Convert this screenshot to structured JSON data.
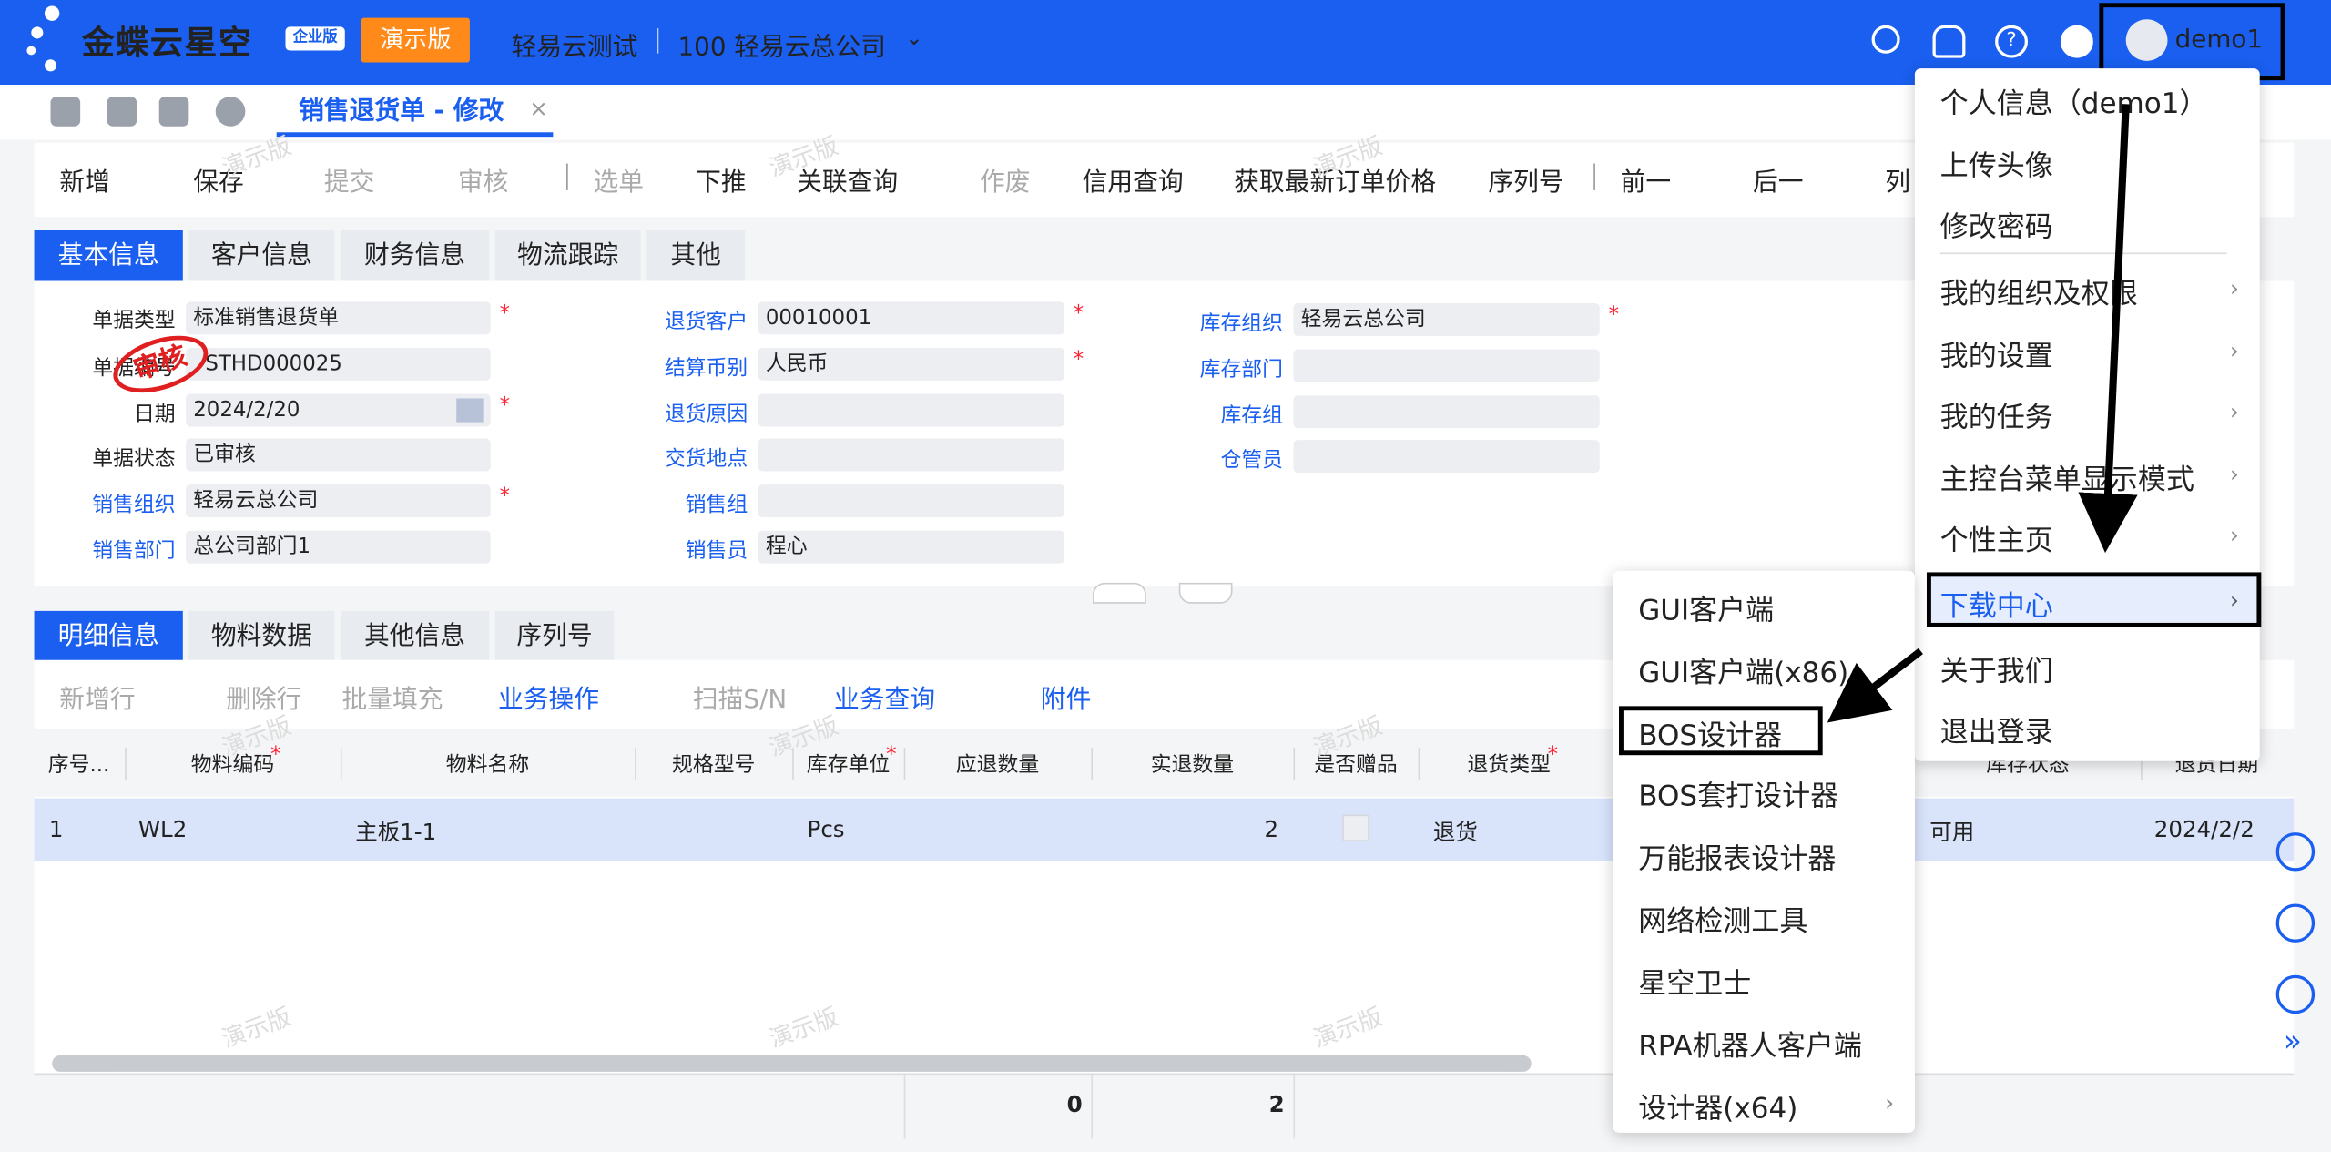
{
  "header": {
    "brand": "金蝶云星空",
    "edition": "企业版",
    "demo": "演示版",
    "org_title": "轻易云测试",
    "org_name": "100 轻易云总公司",
    "user": "demo1"
  },
  "page_tab": "销售退货单 - 修改",
  "toolbar": [
    "新增",
    "保存",
    "提交",
    "审核",
    "选单",
    "下推",
    "关联查询",
    "作废",
    "信用查询",
    "获取最新订单价格",
    "序列号",
    "前一",
    "后一",
    "列"
  ],
  "form_tabs": [
    "基本信息",
    "客户信息",
    "财务信息",
    "物流跟踪",
    "其他"
  ],
  "form": {
    "doc_type_label": "单据类型",
    "doc_type": "标准销售退货单",
    "doc_no_label": "单据编号",
    "doc_no": "STHD000025",
    "date_label": "日期",
    "date": "2024/2/20",
    "status_label": "单据状态",
    "status": "已审核",
    "sales_org_label": "销售组织",
    "sales_org": "轻易云总公司",
    "sales_dept_label": "销售部门",
    "sales_dept": "总公司部门1",
    "return_cust_label": "退货客户",
    "return_cust": "00010001",
    "currency_label": "结算币别",
    "currency": "人民币",
    "reason_label": "退货原因",
    "delivery_label": "交货地点",
    "sales_group_label": "销售组",
    "salesman_label": "销售员",
    "salesman": "程心",
    "stock_org_label": "库存组织",
    "stock_org": "轻易云总公司",
    "stock_dept_label": "库存部门",
    "stock_group_label": "库存组",
    "keeper_label": "仓管员",
    "stamp": "审核"
  },
  "detail_tabs": [
    "明细信息",
    "物料数据",
    "其他信息",
    "序列号"
  ],
  "detail_toolbar": [
    "新增行",
    "删除行",
    "批量填充",
    "业务操作",
    "扫描S/N",
    "业务查询",
    "附件"
  ],
  "columns": [
    "序号...",
    "物料编码",
    "物料名称",
    "规格型号",
    "库存单位",
    "应退数量",
    "实退数量",
    "是否赠品",
    "退货类型",
    "库存状态",
    "退货日期"
  ],
  "row": {
    "seq": "1",
    "code": "WL2",
    "name": "主板1-1",
    "unit": "Pcs",
    "qty": "2",
    "type": "退货",
    "stock_status": "可用",
    "date": "2024/2/2"
  },
  "footer": {
    "due_total": "0",
    "actual_total": "2"
  },
  "user_menu": [
    "个人信息（demo1）",
    "上传头像",
    "修改密码",
    "我的组织及权限",
    "我的设置",
    "我的任务",
    "主控台菜单显示模式",
    "个性主页",
    "下载中心",
    "关于我们",
    "退出登录"
  ],
  "download_menu": [
    "GUI客户端",
    "GUI客户端(x86)",
    "BOS设计器",
    "BOS套打设计器",
    "万能报表设计器",
    "网络检测工具",
    "星空卫士",
    "RPA机器人客户端",
    "设计器(x64)"
  ],
  "watermark": "演示版"
}
